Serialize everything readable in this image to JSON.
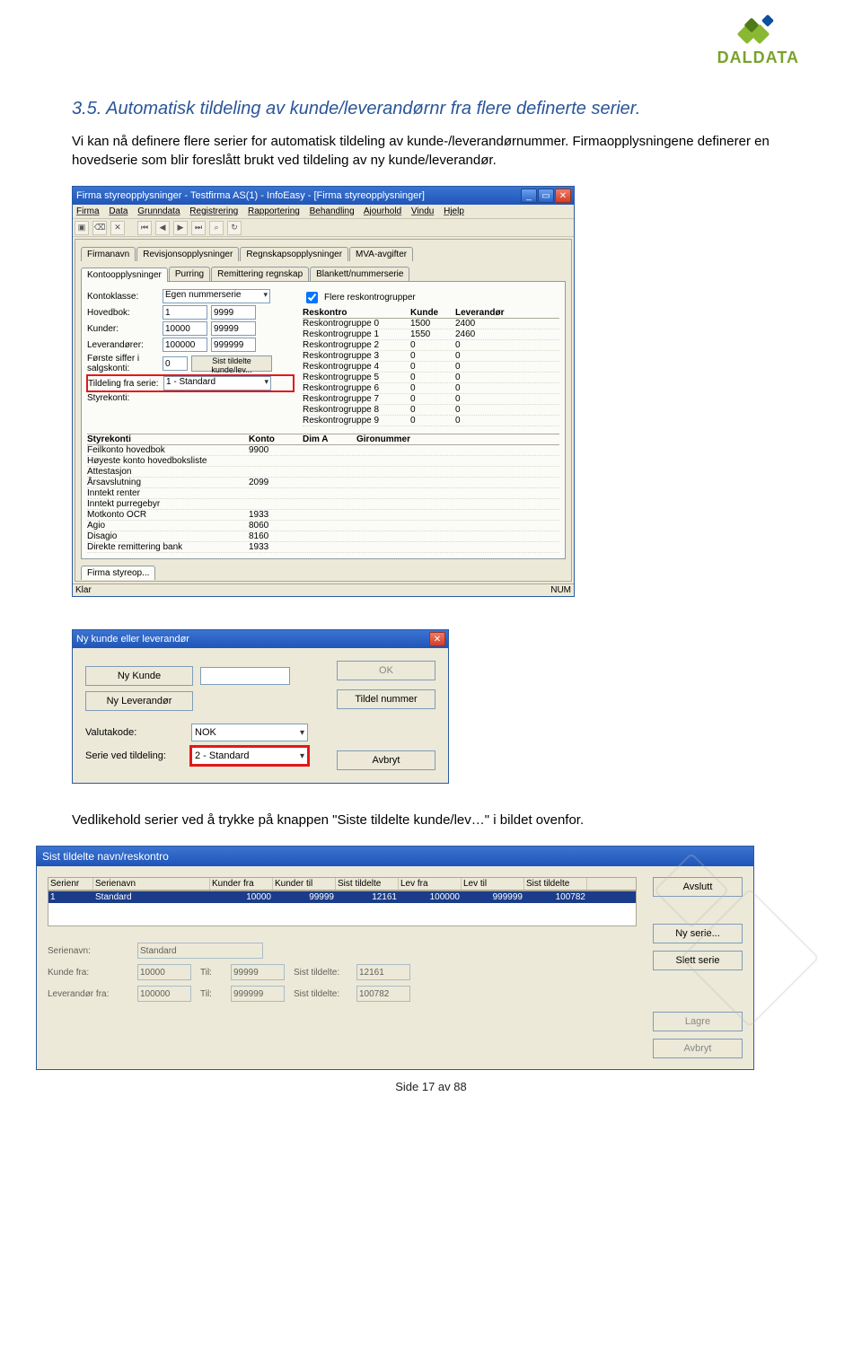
{
  "logo_text": "DALDATA",
  "section_title": "3.5. Automatisk tildeling av kunde/leverandørnr fra flere definerte serier.",
  "para1": "Vi kan nå definere flere serier for automatisk tildeling av kunde-/leverandørnummer. Firmaopplysningene definerer en hovedserie som blir foreslått brukt ved tildeling av ny kunde/leverandør.",
  "para2": "Vedlikehold serier ved å trykke på knappen \"Siste tildelte kunde/lev…\" i bildet ovenfor.",
  "footer": "Side 17 av 88",
  "app1": {
    "title": "Firma styreopplysninger - Testfirma AS(1) - InfoEasy - [Firma styreopplysninger]",
    "menu": [
      "Firma",
      "Data",
      "Grunndata",
      "Registrering",
      "Rapportering",
      "Behandling",
      "Ajourhold",
      "Vindu",
      "Hjelp"
    ],
    "tabs_row1": [
      "Firmanavn",
      "Revisjonsopplysninger",
      "Regnskapsopplysninger",
      "MVA-avgifter"
    ],
    "tabs_row2": [
      "Kontoopplysninger",
      "Purring",
      "Remittering regnskap",
      "Blankett/nummerserie"
    ],
    "konto_label": "Kontoklasse:",
    "konto_value": "Egen nummerserie",
    "hovedbok_label": "Hovedbok:",
    "hovedbok_from": "1",
    "hovedbok_to": "9999",
    "kunder_label": "Kunder:",
    "kunder_from": "10000",
    "kunder_to": "99999",
    "lev_label": "Leverandører:",
    "lev_from": "100000",
    "lev_to": "999999",
    "forste_label": "Første siffer i salgskonti:",
    "forste_val": "0",
    "sist_btn": "Sist tildelte kunde/lev...",
    "tildeling_label": "Tildeling fra serie:",
    "tildeling_val": "1 - Standard",
    "styrekonti_label": "Styrekonti:",
    "flere_cb": "Flere reskontrogrupper",
    "res_head": [
      "Reskontro",
      "Kunde",
      "Leverandør"
    ],
    "res_rows": [
      [
        "Reskontrogruppe 0",
        "1500",
        "2400"
      ],
      [
        "Reskontrogruppe 1",
        "1550",
        "2460"
      ],
      [
        "Reskontrogruppe 2",
        "0",
        "0"
      ],
      [
        "Reskontrogruppe 3",
        "0",
        "0"
      ],
      [
        "Reskontrogruppe 4",
        "0",
        "0"
      ],
      [
        "Reskontrogruppe 5",
        "0",
        "0"
      ],
      [
        "Reskontrogruppe 6",
        "0",
        "0"
      ],
      [
        "Reskontrogruppe 7",
        "0",
        "0"
      ],
      [
        "Reskontrogruppe 8",
        "0",
        "0"
      ],
      [
        "Reskontrogruppe 9",
        "0",
        "0"
      ]
    ],
    "styre_head": [
      "Styrekonti",
      "Konto",
      "Dim A",
      "Gironummer"
    ],
    "styre_rows": [
      [
        "Feilkonto hovedbok",
        "9900",
        "",
        ""
      ],
      [
        "Høyeste konto hovedboksliste",
        "",
        "",
        ""
      ],
      [
        "Attestasjon",
        "",
        "",
        ""
      ],
      [
        "Årsavslutning",
        "2099",
        "",
        ""
      ],
      [
        "Inntekt renter",
        "",
        "",
        ""
      ],
      [
        "Inntekt purregebyr",
        "",
        "",
        ""
      ],
      [
        "Motkonto OCR",
        "1933",
        "",
        ""
      ],
      [
        "Agio",
        "8060",
        "",
        ""
      ],
      [
        "Disagio",
        "8160",
        "",
        ""
      ],
      [
        "Direkte remittering bank",
        "1933",
        "",
        ""
      ]
    ],
    "app_tab": "Firma styreop...",
    "status_left": "Klar",
    "status_right": "NUM"
  },
  "dlg2": {
    "title": "Ny kunde eller leverandør",
    "ny_kunde": "Ny Kunde",
    "ny_lev": "Ny Leverandør",
    "valuta_label": "Valutakode:",
    "valuta_val": "NOK",
    "serie_label": "Serie ved tildeling:",
    "serie_val": "2 - Standard",
    "ok": "OK",
    "tildel": "Tildel nummer",
    "avbryt": "Avbryt"
  },
  "dlg3": {
    "title": "Sist tildelte navn/reskontro",
    "cols": [
      "Serienr",
      "Serienavn",
      "Kunder fra",
      "Kunder til",
      "Sist tildelte",
      "Lev fra",
      "Lev til",
      "Sist tildelte"
    ],
    "row": [
      "1",
      "Standard",
      "10000",
      "99999",
      "12161",
      "100000",
      "999999",
      "100782"
    ],
    "avslutt": "Avslutt",
    "ny_serie": "Ny serie...",
    "slett": "Slett serie",
    "lagre": "Lagre",
    "avbryt": "Avbryt",
    "serienavn_label": "Serienavn:",
    "serienavn_val": "Standard",
    "kunde_fra_label": "Kunde fra:",
    "kunde_fra": "10000",
    "til_label": "Til:",
    "kunde_til": "99999",
    "sist_label": "Sist tildelte:",
    "kunde_sist": "12161",
    "lev_fra_label": "Leverandør fra:",
    "lev_fra": "100000",
    "lev_til": "999999",
    "lev_sist": "100782"
  }
}
